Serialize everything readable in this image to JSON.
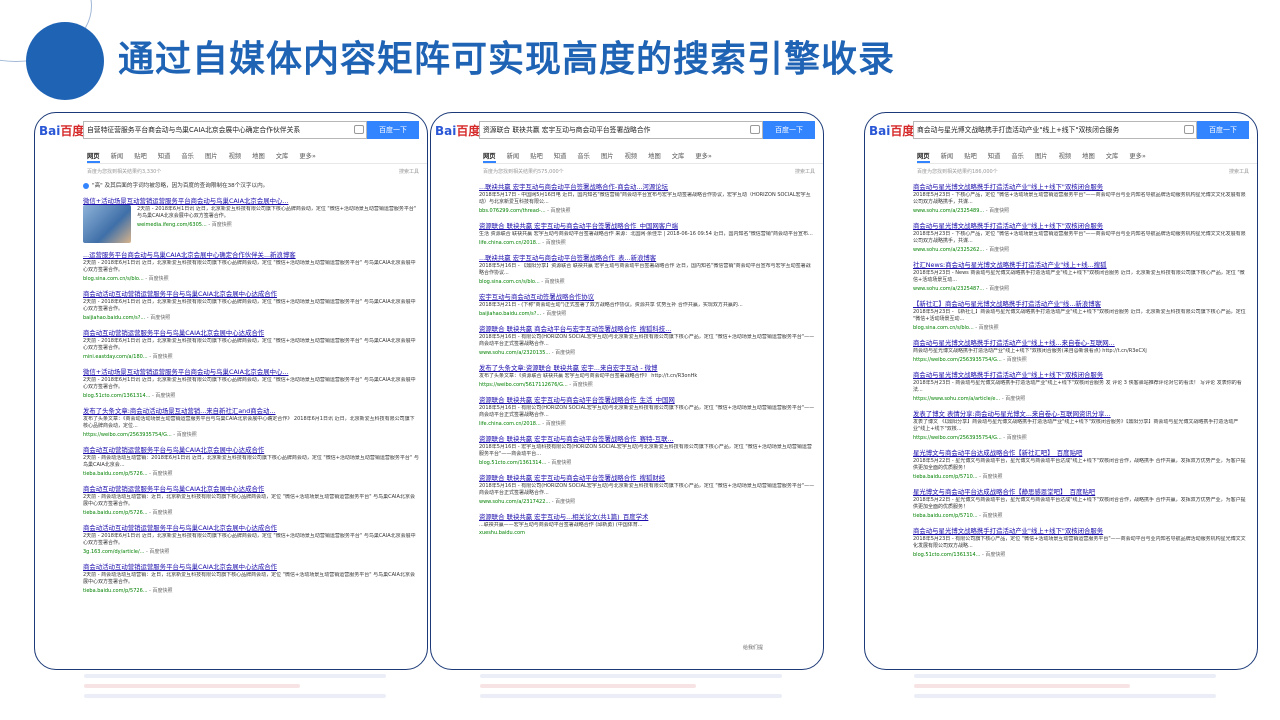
{
  "slide": {
    "title": "通过自媒体内容矩阵可实现高度的搜索引擎收录"
  },
  "colors": {
    "title": "#1f63b5",
    "link": "#1a0dab",
    "url": "#008000",
    "accent": "#3385ff"
  },
  "shots": [
    {
      "logo": "百度",
      "query": "自营特征营服务平台商会动与鸟巢CAIA北京会展中心确定合作伙伴关系",
      "button": "百度一下",
      "tabs": [
        "网页",
        "新闻",
        "贴吧",
        "知道",
        "音乐",
        "图片",
        "视频",
        "地图",
        "文库",
        "更多»"
      ],
      "stats": "百度为您找到相关结果约3,330个",
      "tool": "搜索工具",
      "notice": "\"高\" 及其后面的字词均被忽略，因为百度的查询限制在38个汉字以内。",
      "image_result": {
        "title": "微信+活动场景互动营销运营服务平台商会动与鸟巢CAIA北京会展中心...",
        "desc": "2天前 - 2018年6月1日讯 近日，北京新爱互科技有限公司旗下核心品牌商会动，定位 \"微信+活动场景互动营销运营服务平台\" 与鸟巢CAIA北京会展中心双方签署合作。",
        "url": "weimedia.ifeng.com/6305...",
        "kz": "百度快照"
      },
      "results": [
        {
          "title": "...运营服务平台商会动与鸟巢CAIA北京会展中心确定合作伙伴关...新浪博客",
          "desc": "2天前 - 2018年6月1日讯 近日，北京新爱互科技有限公司旗下核心品牌商会动，定位 \"微信+活动场景互动营销运营服务平台\" 与鸟巢CAIA北京会展中心双方签署合作。",
          "url": "blog.sina.com.cn/s/blo...",
          "kz": "百度快照"
        },
        {
          "title": "商会动活动互动营销运营服务平台与鸟巢CAIA北京会展中心达成合作",
          "desc": "2天前 - 2018年6月1日讯 近日，北京新爱互科技有限公司旗下核心品牌商会动，定位 \"微信+活动场景互动营销运营服务平台\" 与鸟巢CAIA北京会展中心双方签署合作。",
          "url": "baijiahao.baidu.com/s?...",
          "kz": "百度快照"
        },
        {
          "title": "商会动互动营销运营服务平台与鸟巢CAIA北京会展中心达成合作",
          "desc": "2天前 - 2018年6月1日讯 近日，北京新爱互科技有限公司旗下核心品牌商会动，定位 \"微信+活动场景互动营销运营服务平台\" 与鸟巢CAIA北京会展中心双方签署合作。",
          "url": "mini.eastday.com/a/180...",
          "kz": "百度快照"
        },
        {
          "title": "微信+活动场景互动营销运营服务平台商会动与鸟巢CAIA北京会展中心...",
          "desc": "2天前 - 2018年6月1日讯 近日，北京新爱互科技有限公司旗下核心品牌商会动，定位 \"微信+活动场景互动营销运营服务平台\" 与鸟巢CAIA北京会展中心双方签署合作。",
          "url": "blog.51cto.com/1361314...",
          "kz": "百度快照"
        },
        {
          "title": "发布了头条文章:商会动活动场景互动营销...来自新社汇and商会动...",
          "desc": "发布了头条文章：《商会动活动场景互动营销运营服务平台与鸟巢CAIA北京会展中心确定合作》 2018年6月1日讯 近日，北京新爱互科技有限公司旗下核心品牌商会动，定位...",
          "url": "https://weibo.com/2563935754/G...",
          "kz": "百度快照"
        },
        {
          "title": "商会动互动营销运营服务平台与鸟巢CAIA北京会展中心达成合作",
          "desc": "2天前 - 商会动活动互动营销：2018年6月1日讯 近日，北京新爱互科技有限公司旗下核心品牌商会动，定位 \"微信+活动场景互动营销运营服务平台\" 与鸟巢CAIA北京会...",
          "url": "tieba.baidu.com/p/5726...",
          "kz": "百度快照"
        },
        {
          "title": "商会动互动营销运营服务平台与鸟巢CAIA北京会展中心达成合作",
          "desc": "2天前 - 商会动活动互动营销：近日，北京新爱互科技有限公司旗下核心品牌商会动，定位 \"微信+活动场景互动营销运营服务平台\" 与鸟巢CAIA北京会展中心双方签署合作。",
          "url": "tieba.baidu.com/p/5726...",
          "kz": "百度快照"
        },
        {
          "title": "商会动活动互动营销运营服务平台与鸟巢CAIA北京会展中心达成合作",
          "desc": "2天前 - 2018年6月1日讯 近日，北京新爱互科技有限公司旗下核心品牌商会动，定位 \"微信+活动场景互动营销运营服务平台\" 与鸟巢CAIA北京会展中心双方签署合作。",
          "url": "3g.163.com/dy/article/...",
          "kz": "百度快照"
        },
        {
          "title": "商会动活动互动营销运营服务平台与鸟巢CAIA北京会展中心达成合作",
          "desc": "2天前 - 商会动活动互动营销：近日，北京新爱互科技有限公司旗下核心品牌商会动，定位 \"微信+活动场景互动营销运营服务平台\" 与鸟巢CAIA北京会展中心双方签署合作。",
          "url": "tieba.baidu.com/p/5726...",
          "kz": "百度快照"
        }
      ]
    },
    {
      "logo": "百度",
      "query": "资源联合 联袂共赢 宏宇互动与商会动平台签署战略合作",
      "button": "百度一下",
      "tabs": [
        "网页",
        "新闻",
        "贴吧",
        "知道",
        "音乐",
        "图片",
        "视频",
        "地图",
        "文库",
        "更多»"
      ],
      "stats": "百度为您找到相关结果约575,000个",
      "tool": "搜索工具",
      "results": [
        {
          "title": "...联袂共赢 宏宇互动与商会动平台签署战略合作-商会动...河源论坛",
          "desc": "2018年5月17日 - 中国网5月16日电 近日，国内知名\"微信营销\"商会动平台宣布与宏宇互动签署战略合作协议，宏宇互动（HORIZON SOCIAL宏宇互动）与北京新爱互科技有限公...",
          "url": "bbs.076299.com/thread-...",
          "kz": "百度快照"
        },
        {
          "title": "资源联合 联袂共赢 宏宇互动与商会动平台签署战略合作_中国网客户端",
          "desc": "生活 资源联合 联袂共赢 宏宇互动与商会动平台签署战略合作 来源：北国网·余佳华 | 2018-06-16 09:54 近日，国内知名\"微信营销\"商会动平台宣布...",
          "url": "life.china.com.cn/2018...",
          "kz": "百度快照"
        },
        {
          "title": "...联袂共赢 宏宇互动与商会动平台签署战略合作_表...新浪博客",
          "desc": "2018年5月16日 - 【鼎阳分享】资源联合 联袂共赢 宏宇互动与商会动平台签署战略合作 近日，国内知名\"微信营销\"商会动平台宣布与宏宇互动签署战略合作协议...",
          "url": "blog.sina.com.cn/s/blo...",
          "kz": "百度快照"
        },
        {
          "title": "宏宇互动与商会动互动签署战略合作协议",
          "desc": "2018年3月21日 - (下称\"商会动互动\")正式签署了双方战略合作协议。资源共享 优势互补 合作共赢，实现双方共赢的...",
          "url": "baijiahao.baidu.com/s?...",
          "kz": "百度快照"
        },
        {
          "title": "资源联合 联袂共赢 商会动平台与宏宇互动签署战略合作_搜狐科技...",
          "desc": "2018年5月16日 - 有限公司(HORIZON SOCIAL宏宇互动)与北京新爱互科技有限公司旗下核心产品，定位 \"微信+活动场景互动营销运营服务平台\"——商会动平台正式签署战略合作...",
          "url": "www.sohu.com/a/2320135...",
          "kz": "百度快照"
        },
        {
          "title": "发布了头条文章:资源联合 联袂共赢 宏宇...来自宏宇互动 - 微博",
          "desc": "发布了头条文章：《资源联合 联袂共赢 宏宇互动与商会动平台签署战略合作》 http://t.cn/R3onHk",
          "url": "https://weibo.com/5617112676/G...",
          "kz": "百度快照"
        },
        {
          "title": "资源联合 联袂共赢 宏宇互动与商会动平台签署战略合作_生活_中国网",
          "desc": "2018年5月16日 - 有限公司(HORIZON SOCIAL宏宇互动)与北京新爱互科技有限公司旗下核心产品，定位 \"微信+活动场景互动营销运营服务平台\"——商会动平台正式签署战略合作...",
          "url": "life.china.com.cn/2018...",
          "kz": "百度快照"
        },
        {
          "title": "资源联合 联袂共赢 宏宇互动与商会动平台签署战略合作_赛特-互联...",
          "desc": "2018年5月16日 - 宏宇互动科技有限公司(HORIZON SOCIAL宏宇互动)与北京新爱互科技有限公司旗下核心产品，定位 \"微信+活动场景互动营销运营服务平台\"——商会动平台...",
          "url": "blog.51cto.com/1361314...",
          "kz": "百度快照"
        },
        {
          "title": "资源联合 联袂共赢 宏宇互动与商会动平台签署战略合作_搜狐财经",
          "desc": "2018年5月16日 - 有限公司(HORIZON SOCIAL宏宇互动)与北京新爱互科技有限公司旗下核心产品，定位 \"微信+活动场景互动营销运营服务平台\"——商会动平台正式签署战略合作...",
          "url": "www.sohu.com/a/2317422...",
          "kz": "百度快照"
        },
        {
          "title": "资源联合 联袂共赢 宏宇互动与...相关论文(共1篇)_百度学术",
          "desc": "...联袂共赢——宏宇互动与商会动平台签署战略合作 (邱新勇) (中国体育...",
          "url": "xueshu.baidu.com",
          "kz": ""
        }
      ],
      "feedback": "给我们提"
    },
    {
      "logo": "百度",
      "query": "商会动与星光博文战略携手打造活动产业\"线上+线下\"双核闭合服务",
      "button": "百度一下",
      "tabs": [
        "网页",
        "新闻",
        "贴吧",
        "知道",
        "音乐",
        "图片",
        "视频",
        "地图",
        "文库",
        "更多»"
      ],
      "stats": "百度为您找到相关结果约186,000个",
      "tool": "搜索工具",
      "results": [
        {
          "title": "商会动与星光博文战略携手打造活动产业\"线上+线下\"双核闭合服务",
          "desc": "2018年5月23日 - 下核心产品，定位 \"微信+活动场景互动营销运营服务平台\"——商会动平台与业内知名导航品牌活动服务机构星光博文文化发展有限公司双方战略携手，共谋...",
          "url": "www.sohu.com/a/2325489...",
          "kz": "百度快照"
        },
        {
          "title": "商会动与星光博文战略携手打造活动产业\"线上+线下\"双核闭合服务",
          "desc": "2018年5月23日 - 下核心产品，定位 \"微信+活动场景互动营销运营服务平台\"——商会动平台与业内知名导航品牌活动服务机构星光博文文化发展有限公司双方战略携手，共谋...",
          "url": "www.sohu.com/a/2325262...",
          "kz": "百度快照"
        },
        {
          "title": "社汇News:商会动与星光博文战略携手打造活动产业\"线上+线...搜狐",
          "desc": "2018年5月23日 - News 商会动与星光博文战略携手打造活动产业\"线上+线下\"双核闭合服务 近日，北京新爱互科技有限公司旗下核心产品，定位 \"微信+活动场景互动...",
          "url": "www.sohu.com/a/2325487...",
          "kz": "百度快照"
        },
        {
          "title": "【新社汇】商会动与星光博文战略携手打造活动产业\"线...新浪博客",
          "desc": "2018年5月23日 - 【新社汇】商会动与星光博文战略携手打造活动产业\"线上+线下\"双核闭合服务 近日，北京新爱互科技有限公司旗下核心产品，定位 \"微信+活动场景互动...",
          "url": "blog.sina.com.cn/s/blo...",
          "kz": "百度快照"
        },
        {
          "title": "商会动与星光博文战略携手打造活动产业\"线上+线...来自卷心-互联网...",
          "desc": "商会动与星光博文战略携手打造活动产业\"线上+线下\"双核闭合服务(来自@新浪看点) http://t.cn/R3eCXj",
          "url": "https://weibo.com/2563935754/G...",
          "kz": "百度快照"
        },
        {
          "title": "商会动与星光博文战略携手打造活动产业\"线上+线下\"双核闭合服务",
          "desc": "2018年5月23日 - 商会动与星光博文战略携手打造活动产业\"线上+线下\"双核闭合服务 发 评论 3 侠客驿站推荐评论对它的看法！ 写评论 发表你的看法...",
          "url": "https://www.sohu.com/a/article/e...",
          "kz": "百度快照"
        },
        {
          "title": "发表了博文 表情分享:商会动与星光博文...来自卷心-互联网资讯分享...",
          "desc": "发表了博文 《【鼎阳分享】商会动与星光博文战略携手打造活动产业\"线上+线下\"双核闭合服务》【鼎阳分享】商会动与星光博文战略携手打造活动产业\"线上+线下\"双核...",
          "url": "https://weibo.com/2563935754/G...",
          "kz": "百度快照"
        },
        {
          "title": "星光博文与商会动平台达成战略合作【新社汇吧】_百度贴吧",
          "desc": "2018年5月22日 - 星光博文与商会动平台，星光博文与商会动平台达成\"线上+线下\"双核闭合合作，战略携手 合作共赢，发挥双方优势产业，为客户提供更加全面的优质服务！",
          "url": "tieba.baidu.com/p/5710...",
          "kz": "百度快照"
        },
        {
          "title": "星光博文与商会动平台达成战略合作【静思感恩堂吧】_百度贴吧",
          "desc": "2018年5月22日 - 星光博文与商会动平台，星光博文与商会动平台达成\"线上+线下\"双核闭合合作，战略携手 合作共赢，发挥双方优势产业，为客户提供更加全面的优质服务！",
          "url": "tieba.baidu.com/p/5710...",
          "kz": "百度快照"
        },
        {
          "title": "商会动与星光博文战略携手打造活动产业\"线上+线下\"双核闭合服务",
          "desc": "2018年5月23日 - 有限公司旗下核心产品，定位 \"微信+活动场景互动营销运营服务平台\"——商会动平台与业内知名导航品牌活动服务机构星光博文文化发展有限公司双方战略...",
          "url": "blog.51cto.com/1361314...",
          "kz": "百度快照"
        }
      ]
    }
  ]
}
